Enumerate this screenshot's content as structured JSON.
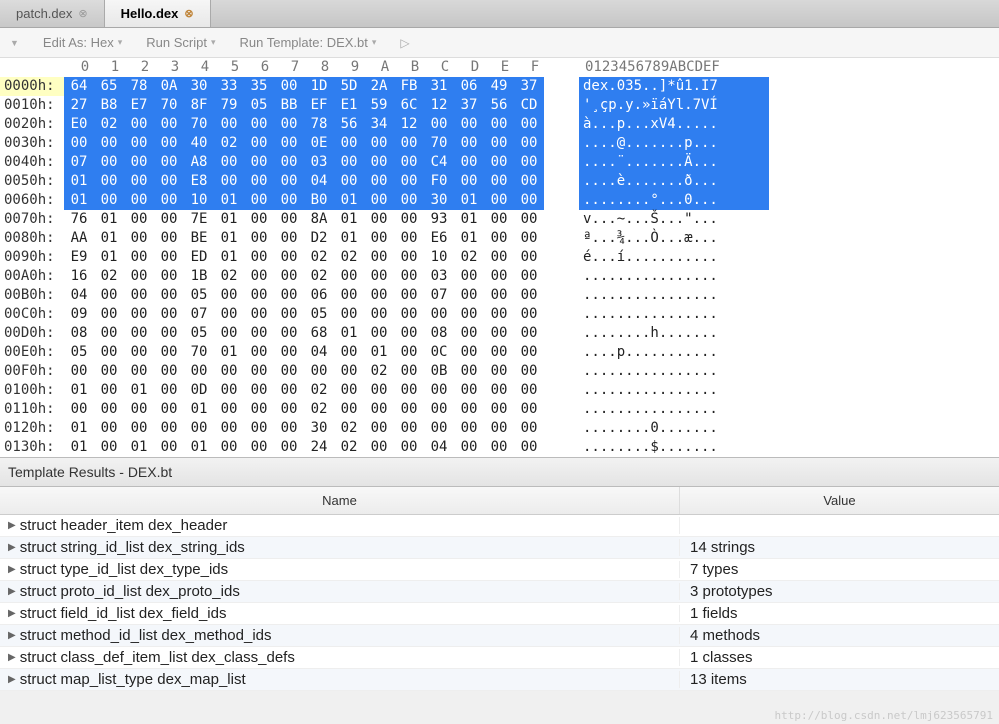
{
  "tabs": [
    {
      "label": "patch.dex",
      "active": false
    },
    {
      "label": "Hello.dex",
      "active": true
    }
  ],
  "toolbar": {
    "edit_as": "Edit As: Hex",
    "run_script": "Run Script",
    "run_template": "Run Template: DEX.bt"
  },
  "hex_column_labels": [
    "0",
    "1",
    "2",
    "3",
    "4",
    "5",
    "6",
    "7",
    "8",
    "9",
    "A",
    "B",
    "C",
    "D",
    "E",
    "F"
  ],
  "ascii_column_label": "0123456789ABCDEF",
  "rows": [
    {
      "addr": "0000h:",
      "hex": [
        "64",
        "65",
        "78",
        "0A",
        "30",
        "33",
        "35",
        "00",
        "1D",
        "5D",
        "2A",
        "FB",
        "31",
        "06",
        "49",
        "37"
      ],
      "ascii": "dex.035..]*û1.I7",
      "sel": 16,
      "hl": true
    },
    {
      "addr": "0010h:",
      "hex": [
        "27",
        "B8",
        "E7",
        "70",
        "8F",
        "79",
        "05",
        "BB",
        "EF",
        "E1",
        "59",
        "6C",
        "12",
        "37",
        "56",
        "CD"
      ],
      "ascii": "'¸çp.y.»ïáYl.7VÍ",
      "sel": 16
    },
    {
      "addr": "0020h:",
      "hex": [
        "E0",
        "02",
        "00",
        "00",
        "70",
        "00",
        "00",
        "00",
        "78",
        "56",
        "34",
        "12",
        "00",
        "00",
        "00",
        "00"
      ],
      "ascii": "à...p...xV4.....",
      "sel": 16
    },
    {
      "addr": "0030h:",
      "hex": [
        "00",
        "00",
        "00",
        "00",
        "40",
        "02",
        "00",
        "00",
        "0E",
        "00",
        "00",
        "00",
        "70",
        "00",
        "00",
        "00"
      ],
      "ascii": "....@.......p...",
      "sel": 16
    },
    {
      "addr": "0040h:",
      "hex": [
        "07",
        "00",
        "00",
        "00",
        "A8",
        "00",
        "00",
        "00",
        "03",
        "00",
        "00",
        "00",
        "C4",
        "00",
        "00",
        "00"
      ],
      "ascii": "....¨.......Ä...",
      "sel": 16
    },
    {
      "addr": "0050h:",
      "hex": [
        "01",
        "00",
        "00",
        "00",
        "E8",
        "00",
        "00",
        "00",
        "04",
        "00",
        "00",
        "00",
        "F0",
        "00",
        "00",
        "00"
      ],
      "ascii": "....è.......ð...",
      "sel": 16
    },
    {
      "addr": "0060h:",
      "hex": [
        "01",
        "00",
        "00",
        "00",
        "10",
        "01",
        "00",
        "00",
        "B0",
        "01",
        "00",
        "00",
        "30",
        "01",
        "00",
        "00"
      ],
      "ascii": "........°...0...",
      "sel": 16
    },
    {
      "addr": "0070h:",
      "hex": [
        "76",
        "01",
        "00",
        "00",
        "7E",
        "01",
        "00",
        "00",
        "8A",
        "01",
        "00",
        "00",
        "93",
        "01",
        "00",
        "00"
      ],
      "ascii": "v...~...Š...\"...",
      "sel": 0
    },
    {
      "addr": "0080h:",
      "hex": [
        "AA",
        "01",
        "00",
        "00",
        "BE",
        "01",
        "00",
        "00",
        "D2",
        "01",
        "00",
        "00",
        "E6",
        "01",
        "00",
        "00"
      ],
      "ascii": "ª...¾...Ò...æ...",
      "sel": 0
    },
    {
      "addr": "0090h:",
      "hex": [
        "E9",
        "01",
        "00",
        "00",
        "ED",
        "01",
        "00",
        "00",
        "02",
        "02",
        "00",
        "00",
        "10",
        "02",
        "00",
        "00"
      ],
      "ascii": "é...í...........",
      "sel": 0
    },
    {
      "addr": "00A0h:",
      "hex": [
        "16",
        "02",
        "00",
        "00",
        "1B",
        "02",
        "00",
        "00",
        "02",
        "00",
        "00",
        "00",
        "03",
        "00",
        "00",
        "00"
      ],
      "ascii": "................",
      "sel": 0
    },
    {
      "addr": "00B0h:",
      "hex": [
        "04",
        "00",
        "00",
        "00",
        "05",
        "00",
        "00",
        "00",
        "06",
        "00",
        "00",
        "00",
        "07",
        "00",
        "00",
        "00"
      ],
      "ascii": "................",
      "sel": 0
    },
    {
      "addr": "00C0h:",
      "hex": [
        "09",
        "00",
        "00",
        "00",
        "07",
        "00",
        "00",
        "00",
        "05",
        "00",
        "00",
        "00",
        "00",
        "00",
        "00",
        "00"
      ],
      "ascii": "................",
      "sel": 0
    },
    {
      "addr": "00D0h:",
      "hex": [
        "08",
        "00",
        "00",
        "00",
        "05",
        "00",
        "00",
        "00",
        "68",
        "01",
        "00",
        "00",
        "08",
        "00",
        "00",
        "00"
      ],
      "ascii": "........h.......",
      "sel": 0
    },
    {
      "addr": "00E0h:",
      "hex": [
        "05",
        "00",
        "00",
        "00",
        "70",
        "01",
        "00",
        "00",
        "04",
        "00",
        "01",
        "00",
        "0C",
        "00",
        "00",
        "00"
      ],
      "ascii": "....p...........",
      "sel": 0
    },
    {
      "addr": "00F0h:",
      "hex": [
        "00",
        "00",
        "00",
        "00",
        "00",
        "00",
        "00",
        "00",
        "00",
        "00",
        "02",
        "00",
        "0B",
        "00",
        "00",
        "00"
      ],
      "ascii": "................",
      "sel": 0
    },
    {
      "addr": "0100h:",
      "hex": [
        "01",
        "00",
        "01",
        "00",
        "0D",
        "00",
        "00",
        "00",
        "02",
        "00",
        "00",
        "00",
        "00",
        "00",
        "00",
        "00"
      ],
      "ascii": "................",
      "sel": 0
    },
    {
      "addr": "0110h:",
      "hex": [
        "00",
        "00",
        "00",
        "00",
        "01",
        "00",
        "00",
        "00",
        "02",
        "00",
        "00",
        "00",
        "00",
        "00",
        "00",
        "00"
      ],
      "ascii": "................",
      "sel": 0
    },
    {
      "addr": "0120h:",
      "hex": [
        "01",
        "00",
        "00",
        "00",
        "00",
        "00",
        "00",
        "00",
        "30",
        "02",
        "00",
        "00",
        "00",
        "00",
        "00",
        "00"
      ],
      "ascii": "........0.......",
      "sel": 0
    },
    {
      "addr": "0130h:",
      "hex": [
        "01",
        "00",
        "01",
        "00",
        "01",
        "00",
        "00",
        "00",
        "24",
        "02",
        "00",
        "00",
        "04",
        "00",
        "00",
        "00"
      ],
      "ascii": "........$.......",
      "sel": 0
    }
  ],
  "template_header": "Template Results - DEX.bt",
  "grid_header": {
    "name": "Name",
    "value": "Value"
  },
  "results": [
    {
      "name": "struct header_item dex_header",
      "value": ""
    },
    {
      "name": "struct string_id_list dex_string_ids",
      "value": "14 strings"
    },
    {
      "name": "struct type_id_list dex_type_ids",
      "value": "7 types"
    },
    {
      "name": "struct proto_id_list dex_proto_ids",
      "value": "3 prototypes"
    },
    {
      "name": "struct field_id_list dex_field_ids",
      "value": "1 fields"
    },
    {
      "name": "struct method_id_list dex_method_ids",
      "value": "4 methods"
    },
    {
      "name": "struct class_def_item_list dex_class_defs",
      "value": "1 classes"
    },
    {
      "name": "struct map_list_type dex_map_list",
      "value": "13 items"
    }
  ],
  "watermark": "http://blog.csdn.net/lmj623565791"
}
